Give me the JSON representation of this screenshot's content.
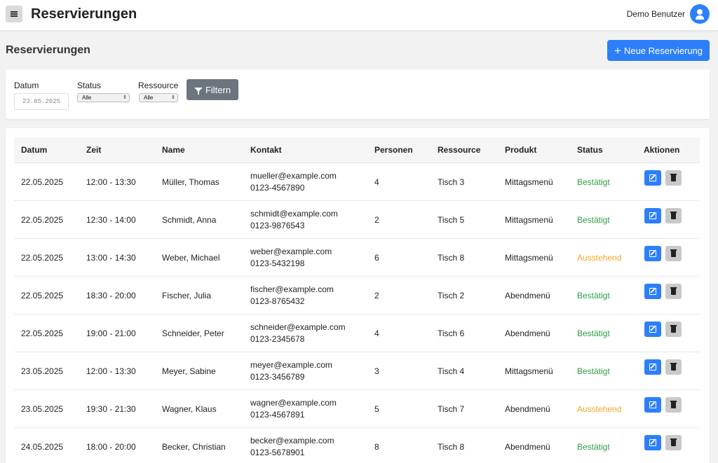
{
  "header": {
    "app_title": "Reservierungen",
    "user_name": "Demo Benutzer"
  },
  "page": {
    "title": "Reservierungen",
    "new_button": "Neue Reservierung"
  },
  "filters": {
    "date_label": "Datum",
    "date_placeholder": "23.05.2025",
    "status_label": "Status",
    "status_value": "Alle",
    "resource_label": "Ressource",
    "resource_value": "Alle",
    "filter_button": "Filtern"
  },
  "table": {
    "columns": [
      "Datum",
      "Zeit",
      "Name",
      "Kontakt",
      "Personen",
      "Ressource",
      "Produkt",
      "Status",
      "Aktionen"
    ],
    "rows": [
      {
        "date": "22.05.2025",
        "time": "12:00 - 13:30",
        "name": "Müller, Thomas",
        "email": "mueller@example.com",
        "phone": "0123-4567890",
        "persons": "4",
        "resource": "Tisch 3",
        "product": "Mittagsmenü",
        "status": "Bestätigt",
        "status_type": "ok"
      },
      {
        "date": "22.05.2025",
        "time": "12:30 - 14:00",
        "name": "Schmidt, Anna",
        "email": "schmidt@example.com",
        "phone": "0123-9876543",
        "persons": "2",
        "resource": "Tisch 5",
        "product": "Mittagsmenü",
        "status": "Bestätigt",
        "status_type": "ok"
      },
      {
        "date": "22.05.2025",
        "time": "13:00 - 14:30",
        "name": "Weber, Michael",
        "email": "weber@example.com",
        "phone": "0123-5432198",
        "persons": "6",
        "resource": "Tisch 8",
        "product": "Mittagsmenü",
        "status": "Ausstehend",
        "status_type": "pending"
      },
      {
        "date": "22.05.2025",
        "time": "18:30 - 20:00",
        "name": "Fischer, Julia",
        "email": "fischer@example.com",
        "phone": "0123-8765432",
        "persons": "2",
        "resource": "Tisch 2",
        "product": "Abendmenü",
        "status": "Bestätigt",
        "status_type": "ok"
      },
      {
        "date": "22.05.2025",
        "time": "19:00 - 21:00",
        "name": "Schneider, Peter",
        "email": "schneider@example.com",
        "phone": "0123-2345678",
        "persons": "4",
        "resource": "Tisch 6",
        "product": "Abendmenü",
        "status": "Bestätigt",
        "status_type": "ok"
      },
      {
        "date": "23.05.2025",
        "time": "12:00 - 13:30",
        "name": "Meyer, Sabine",
        "email": "meyer@example.com",
        "phone": "0123-3456789",
        "persons": "3",
        "resource": "Tisch 4",
        "product": "Mittagsmenü",
        "status": "Bestätigt",
        "status_type": "ok"
      },
      {
        "date": "23.05.2025",
        "time": "19:30 - 21:30",
        "name": "Wagner, Klaus",
        "email": "wagner@example.com",
        "phone": "0123-4567891",
        "persons": "5",
        "resource": "Tisch 7",
        "product": "Abendmenü",
        "status": "Ausstehend",
        "status_type": "pending"
      },
      {
        "date": "24.05.2025",
        "time": "18:00 - 20:00",
        "name": "Becker, Christian",
        "email": "becker@example.com",
        "phone": "0123-5678901",
        "persons": "8",
        "resource": "Tisch 8",
        "product": "Abendmenü",
        "status": "Bestätigt",
        "status_type": "ok"
      }
    ]
  },
  "icons": {
    "menu": "hamburger-icon",
    "user": "user-icon",
    "plus": "plus-icon",
    "filter": "funnel-icon",
    "edit": "edit-icon",
    "delete": "trash-icon"
  },
  "colors": {
    "primary": "#2d7ff9",
    "secondary": "#6c757d",
    "confirmed": "#2e9e44",
    "pending": "#f5a623"
  }
}
